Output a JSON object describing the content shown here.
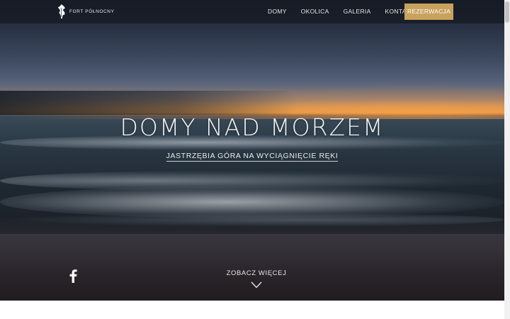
{
  "header": {
    "logo_text": "FORT PÓŁNOCNY",
    "nav": [
      {
        "label": "DOMY"
      },
      {
        "label": "OKOLICA"
      },
      {
        "label": "GALERIA"
      },
      {
        "label": "KONTAKT"
      }
    ],
    "cta_label": "REZERWACJA",
    "cta_color": "#c9a25e"
  },
  "hero": {
    "title": "DOMY NAD MORZEM",
    "subtitle": "JASTRZĘBIA GÓRA NA WYCIĄGNIĘCIE RĘKI",
    "scroll_label": "ZOBACZ WIĘCEJ",
    "background_image": "sea-sunset-beach",
    "social_icon": "facebook-icon",
    "scroll_icon": "chevron-down-icon"
  }
}
